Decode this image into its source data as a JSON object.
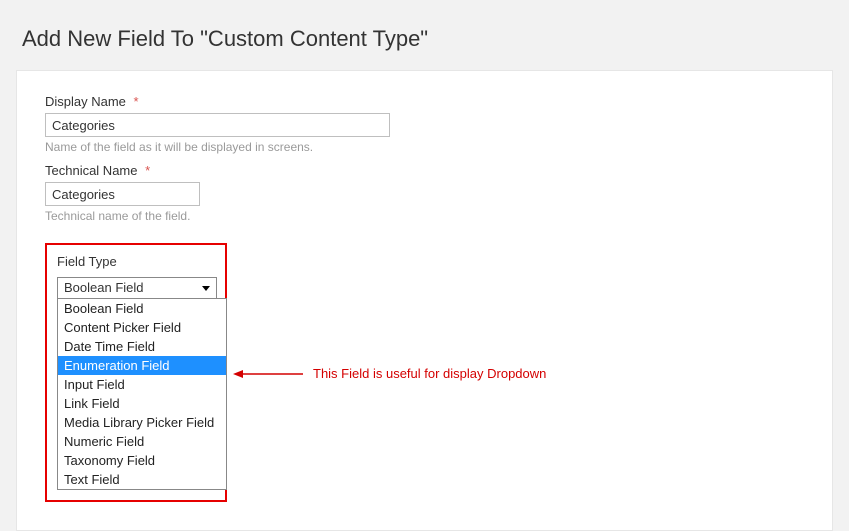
{
  "page": {
    "title": "Add New Field To \"Custom Content Type\""
  },
  "form": {
    "displayName": {
      "label": "Display Name",
      "value": "Categories",
      "help": "Name of the field as it will be displayed in screens."
    },
    "technicalName": {
      "label": "Technical Name",
      "value": "Categories",
      "help": "Technical name of the field."
    },
    "fieldType": {
      "label": "Field Type",
      "selected": "Boolean Field",
      "highlightedIndex": 3,
      "options": [
        "Boolean Field",
        "Content Picker Field",
        "Date Time Field",
        "Enumeration Field",
        "Input Field",
        "Link Field",
        "Media Library Picker Field",
        "Numeric Field",
        "Taxonomy Field",
        "Text Field"
      ]
    }
  },
  "annotation": {
    "text": "This Field is useful for display Dropdown"
  }
}
